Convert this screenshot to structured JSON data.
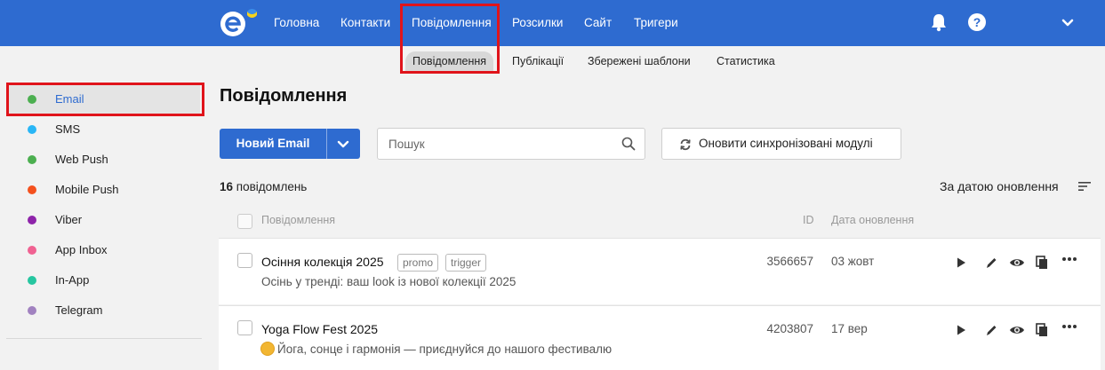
{
  "topnav": {
    "items": [
      {
        "label": "Головна"
      },
      {
        "label": "Контакти"
      },
      {
        "label": "Повідомлення",
        "active": true
      },
      {
        "label": "Розсилки"
      },
      {
        "label": "Сайт"
      },
      {
        "label": "Тригери"
      }
    ],
    "icons": [
      "logo",
      "bell-icon",
      "help-icon",
      "chevron-down-icon"
    ],
    "help_label": "?"
  },
  "subnav": {
    "items": [
      {
        "label": "Повідомлення",
        "active": true
      },
      {
        "label": "Публікації"
      },
      {
        "label": "Збережені шаблони"
      },
      {
        "label": "Статистика"
      }
    ]
  },
  "sidebar": {
    "items": [
      {
        "label": "Email",
        "color": "#4caf50",
        "active": true
      },
      {
        "label": "SMS",
        "color": "#29b6f6"
      },
      {
        "label": "Web Push",
        "color": "#4caf50"
      },
      {
        "label": "Mobile Push",
        "color": "#f4511e"
      },
      {
        "label": "Viber",
        "color": "#8e24aa"
      },
      {
        "label": "App Inbox",
        "color": "#f06292"
      },
      {
        "label": "In-App",
        "color": "#26c6a0"
      },
      {
        "label": "Telegram",
        "color": "#a182c0"
      }
    ]
  },
  "main": {
    "title": "Повідомлення",
    "new_button": "Новий Email",
    "search_placeholder": "Пошук",
    "sync_button": "Оновити синхронізовані модулі",
    "count_number": "16",
    "count_label": " повідомлень",
    "sort_label": "За датою оновлення",
    "table_headers": {
      "message": "Повідомлення",
      "id": "ID",
      "date": "Дата оновлення"
    },
    "rows": [
      {
        "name": "Осіння колекція 2025",
        "tags": [
          "promo",
          "trigger"
        ],
        "description": "Осінь у тренді: ваш look із нової колекції 2025",
        "id": "3566657",
        "date": "03 жовт"
      },
      {
        "name": "Yoga Flow Fest 2025",
        "tags": [],
        "description": "Йога, сонце і гармонія — приєднуйся до нашого фестивалю",
        "id": "4203807",
        "date": "17 вер"
      }
    ],
    "row_actions": [
      "play-icon",
      "edit-icon",
      "view-icon",
      "copy-icon",
      "more-icon"
    ]
  },
  "colors": {
    "brand": "#2e6bd0",
    "highlight": "#e0141b"
  }
}
